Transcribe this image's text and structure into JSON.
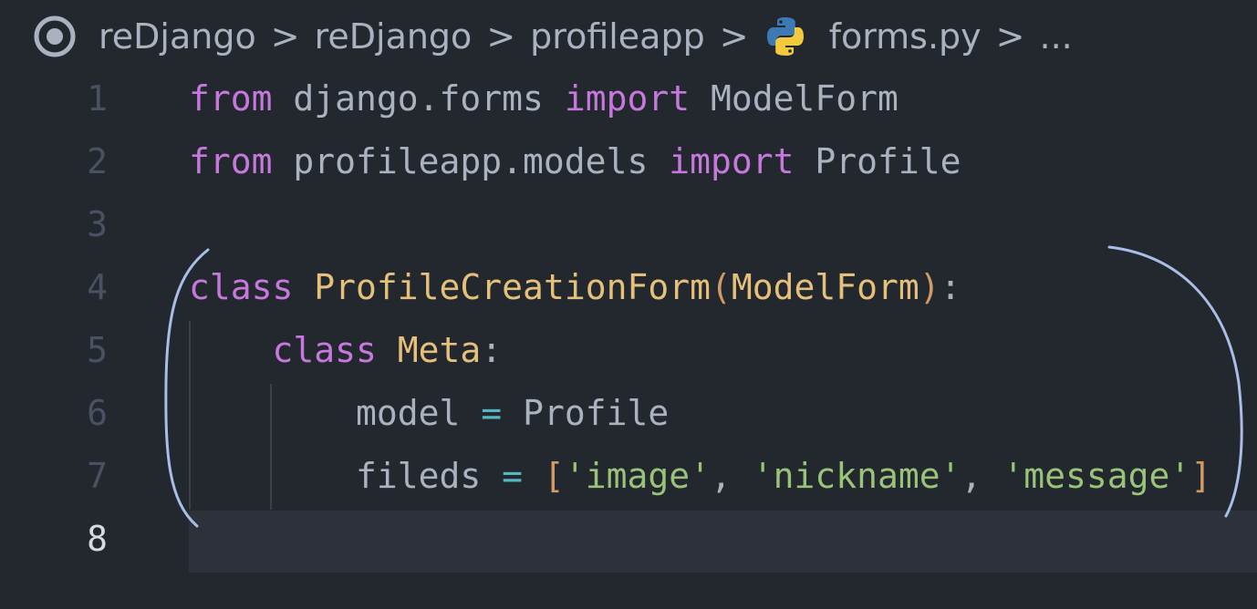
{
  "breadcrumb": {
    "items": [
      "reDjango",
      "reDjango",
      "profileapp",
      "forms.py",
      "..."
    ],
    "separator": ">"
  },
  "code": {
    "lines": [
      {
        "number": "1",
        "tokens": [
          {
            "t": "from",
            "c": "kw"
          },
          {
            "t": " django.forms ",
            "c": "plain"
          },
          {
            "t": "import",
            "c": "kw"
          },
          {
            "t": " ModelForm",
            "c": "plain"
          }
        ]
      },
      {
        "number": "2",
        "tokens": [
          {
            "t": "from",
            "c": "kw"
          },
          {
            "t": " profileapp.models ",
            "c": "plain"
          },
          {
            "t": "import",
            "c": "kw"
          },
          {
            "t": " Profile",
            "c": "plain"
          }
        ]
      },
      {
        "number": "3",
        "tokens": []
      },
      {
        "number": "4",
        "tokens": [
          {
            "t": "class",
            "c": "kw"
          },
          {
            "t": " ",
            "c": "plain"
          },
          {
            "t": "ProfileCreationForm",
            "c": "cls"
          },
          {
            "t": "(",
            "c": "br1"
          },
          {
            "t": "ModelForm",
            "c": "cls"
          },
          {
            "t": ")",
            "c": "br1"
          },
          {
            "t": ":",
            "c": "plain"
          }
        ]
      },
      {
        "number": "5",
        "tokens": [
          {
            "t": "    ",
            "c": "plain"
          },
          {
            "t": "class",
            "c": "kw"
          },
          {
            "t": " ",
            "c": "plain"
          },
          {
            "t": "Meta",
            "c": "cls"
          },
          {
            "t": ":",
            "c": "plain"
          }
        ]
      },
      {
        "number": "6",
        "tokens": [
          {
            "t": "        model ",
            "c": "plain"
          },
          {
            "t": "=",
            "c": "op"
          },
          {
            "t": " Profile",
            "c": "plain"
          }
        ]
      },
      {
        "number": "7",
        "tokens": [
          {
            "t": "        fileds ",
            "c": "plain"
          },
          {
            "t": "=",
            "c": "op"
          },
          {
            "t": " ",
            "c": "plain"
          },
          {
            "t": "[",
            "c": "br1"
          },
          {
            "t": "'image'",
            "c": "str"
          },
          {
            "t": ", ",
            "c": "plain"
          },
          {
            "t": "'nickname'",
            "c": "str"
          },
          {
            "t": ", ",
            "c": "plain"
          },
          {
            "t": "'message'",
            "c": "str"
          },
          {
            "t": "]",
            "c": "br1"
          }
        ]
      },
      {
        "number": "8",
        "tokens": [],
        "current": true
      }
    ]
  },
  "colors": {
    "background": "#23272e",
    "keyword": "#c678dd",
    "class_name": "#e5c07b",
    "operator": "#56b6c2",
    "string": "#98c379",
    "bracket": "#d19a66",
    "plain": "#abb2bf",
    "annotation": "#a9bde8"
  },
  "icons": {
    "source_control": "source-control-icon",
    "python": "python-file-icon"
  }
}
